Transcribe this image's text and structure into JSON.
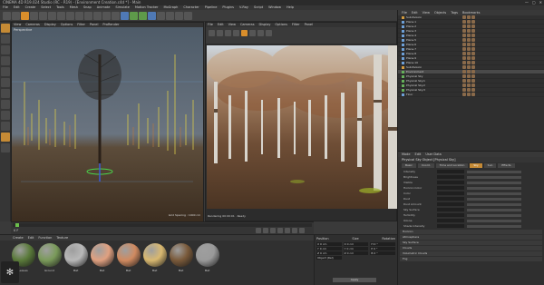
{
  "window": {
    "title": "CINEMA 4D R19.024 Studio (RC - R19) - [Environment Creation.c4d *] - Main",
    "controls": [
      "—",
      "▢",
      "✕"
    ]
  },
  "menubar": [
    "File",
    "Edit",
    "Create",
    "Select",
    "Tools",
    "Mesh",
    "Snap",
    "Animate",
    "Simulate",
    "Motion Tracker",
    "MoGraph",
    "Character",
    "Pipeline",
    "Plugins",
    "V-Ray",
    "Script",
    "Window",
    "Help"
  ],
  "viewport_left": {
    "menu": [
      "View",
      "Cameras",
      "Display",
      "Options",
      "Filter",
      "Panel",
      "ProRender"
    ],
    "label": "Perspective",
    "footer": "Grid Spacing : 1000 cm"
  },
  "viewport_right": {
    "menu": [
      "File",
      "Edit",
      "View",
      "Cameras",
      "Display",
      "Options",
      "Filter",
      "Panel"
    ],
    "status": "Rendering 00:00:01 · Ready"
  },
  "timeline": {
    "frame": "0 F",
    "end_frame": "90 F"
  },
  "materials": {
    "menu": [
      "Create",
      "Edit",
      "Function",
      "Texture"
    ],
    "items": [
      {
        "name": "Leaves",
        "color": "#5a7a3a"
      },
      {
        "name": "Ground",
        "color": "#7a9a5a"
      },
      {
        "name": "Mat",
        "color": "#b8b8b8"
      },
      {
        "name": "Mat",
        "color": "#e0a080"
      },
      {
        "name": "Mat",
        "color": "#d08a60"
      },
      {
        "name": "Mat",
        "color": "#d8b870"
      },
      {
        "name": "Mat",
        "color": "#7a5a3a"
      },
      {
        "name": "Mat",
        "color": "#9a9a9a"
      }
    ]
  },
  "coordinates": {
    "headers": [
      "Position",
      "Size",
      "Rotation"
    ],
    "rows": [
      [
        "X 0 cm",
        "X 0 cm",
        "H 0 °"
      ],
      [
        "Y 0 cm",
        "Y 0 cm",
        "P 0 °"
      ],
      [
        "Z 0 cm",
        "Z 0 cm",
        "B 0 °"
      ]
    ],
    "dropdown": "Object (Rel)",
    "apply": "Apply"
  },
  "object_manager": {
    "menu": [
      "File",
      "Edit",
      "View",
      "Objects",
      "Tags",
      "Bookmarks"
    ],
    "rows": [
      {
        "name": "Subdivision",
        "icon": "orange",
        "selected": false
      },
      {
        "name": "Plane.1",
        "icon": "blue",
        "selected": false
      },
      {
        "name": "Plane.2",
        "icon": "blue",
        "selected": false
      },
      {
        "name": "Plane.3",
        "icon": "blue",
        "selected": false
      },
      {
        "name": "Plane.4",
        "icon": "blue",
        "selected": false
      },
      {
        "name": "Plane.5",
        "icon": "blue",
        "selected": false
      },
      {
        "name": "Plane.6",
        "icon": "blue",
        "selected": false
      },
      {
        "name": "Plane.7",
        "icon": "blue",
        "selected": false
      },
      {
        "name": "Plane.8",
        "icon": "blue",
        "selected": false
      },
      {
        "name": "Plane.9",
        "icon": "blue",
        "selected": false
      },
      {
        "name": "Plane.10",
        "icon": "blue",
        "selected": false
      },
      {
        "name": "Subdivision",
        "icon": "orange",
        "selected": false
      },
      {
        "name": "Environment",
        "icon": "green",
        "selected": true
      },
      {
        "name": "Physical Sky",
        "icon": "green",
        "selected": false
      },
      {
        "name": "Physical Sky.1",
        "icon": "green",
        "selected": false
      },
      {
        "name": "Physical Sky.2",
        "icon": "green",
        "selected": false
      },
      {
        "name": "Physical Sky.3",
        "icon": "green",
        "selected": false
      },
      {
        "name": "Floor",
        "icon": "blue",
        "selected": false
      }
    ]
  },
  "attributes": {
    "menu": [
      "Mode",
      "Edit",
      "User Data"
    ],
    "title": "Physical Sky Object [Physical Sky]",
    "tabs": [
      {
        "label": "Basic",
        "active": false
      },
      {
        "label": "Coord.",
        "active": false
      },
      {
        "label": "Time and Location",
        "active": false
      },
      {
        "label": "Sky",
        "active": true
      },
      {
        "label": "Sun",
        "active": false
      },
      {
        "label": "Effects",
        "active": false
      }
    ],
    "rows": [
      "Intensity",
      "Brightness",
      "Visible",
      "Horizon Color",
      "Color",
      "Dust",
      "Dust Amount",
      "Sky Surface",
      "Turbidity",
      "Ozone",
      "Shade Intensity"
    ],
    "sections": [
      "Horizon",
      "Atmosphere",
      "Sky Surface",
      "Clouds",
      "Volumetric Clouds",
      "Fog"
    ]
  }
}
